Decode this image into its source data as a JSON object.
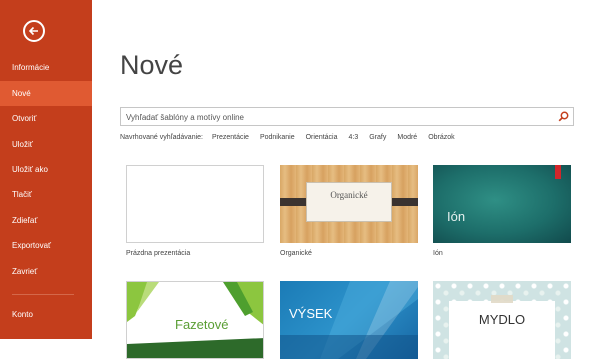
{
  "sidebar": {
    "items": [
      {
        "label": "Informácie"
      },
      {
        "label": "Nové"
      },
      {
        "label": "Otvoriť"
      },
      {
        "label": "Uložiť"
      },
      {
        "label": "Uložiť ako"
      },
      {
        "label": "Tlačiť"
      },
      {
        "label": "Zdieľať"
      },
      {
        "label": "Exportovať"
      },
      {
        "label": "Zavrieť"
      },
      {
        "label": "Konto"
      }
    ]
  },
  "main": {
    "title": "Nové",
    "search": {
      "placeholder": "Vyhľadať šablóny a motívy online"
    },
    "suggested": {
      "label": "Navrhované vyhľadávanie:",
      "items": [
        "Prezentácie",
        "Podnikanie",
        "Orientácia",
        "4:3",
        "Grafy",
        "Modré",
        "Obrázok"
      ]
    },
    "templates": [
      {
        "label": "Prázdna prezentácia",
        "thumb_text": ""
      },
      {
        "label": "Organické",
        "thumb_text": "Organické"
      },
      {
        "label": "Ión",
        "thumb_text": "Ión"
      },
      {
        "label": "",
        "thumb_text": "Fazetové"
      },
      {
        "label": "",
        "thumb_text": "VÝSEK"
      },
      {
        "label": "",
        "thumb_text": "MYDLO"
      }
    ]
  },
  "colors": {
    "sidebar": "#c43e1c",
    "sidebar_active": "#e05a32"
  }
}
